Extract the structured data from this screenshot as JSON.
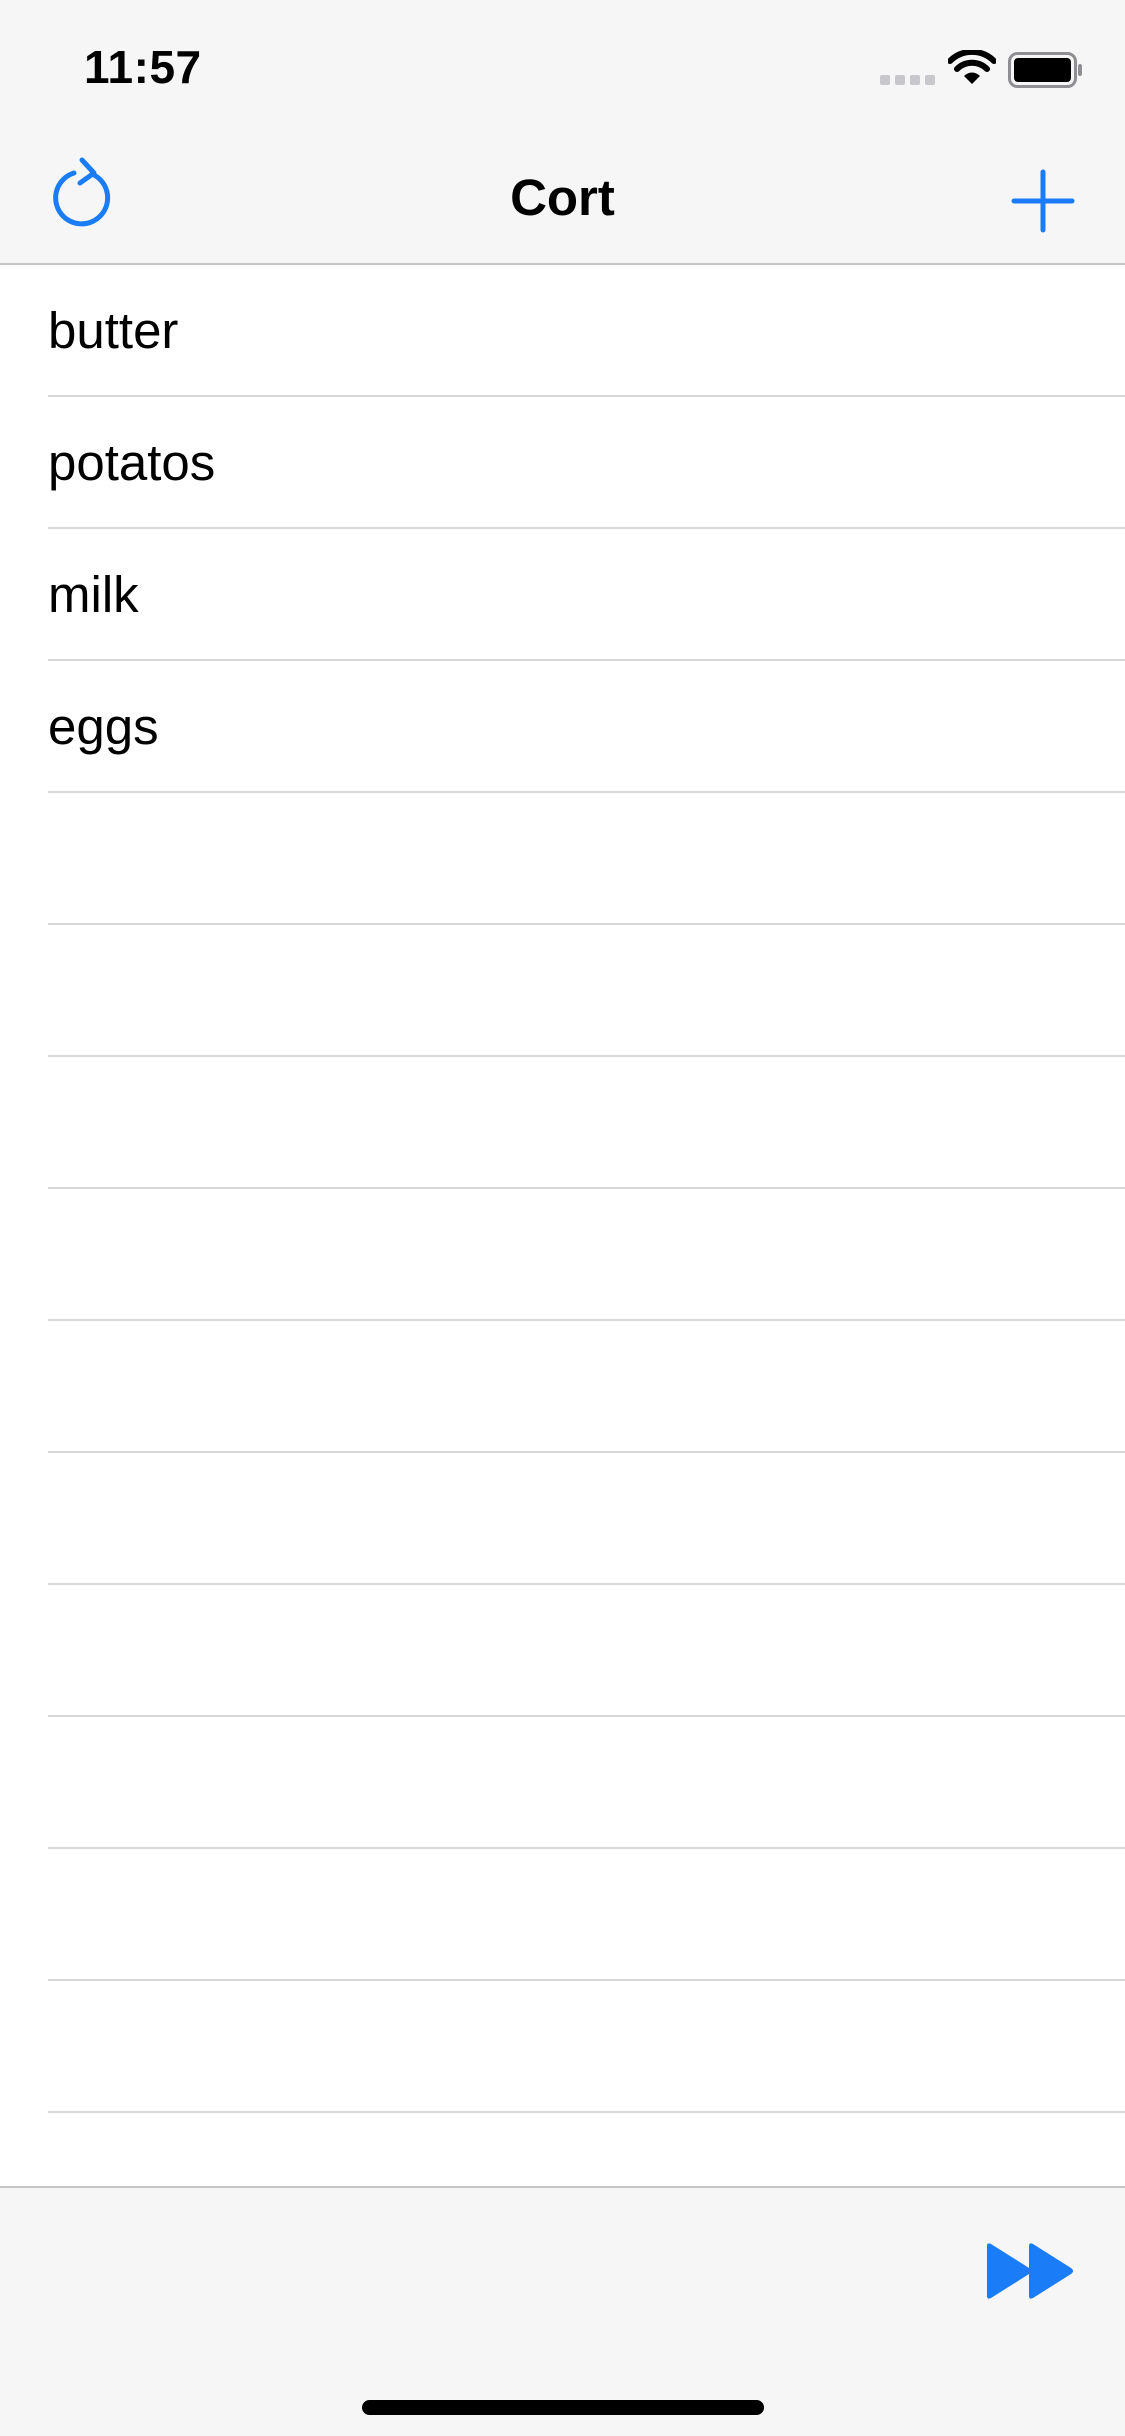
{
  "status_bar": {
    "time": "11:57",
    "icons": [
      "signal-dots-icon",
      "wifi-icon",
      "battery-icon"
    ]
  },
  "nav": {
    "title": "Cort",
    "left_icon": "refresh-icon",
    "right_icon": "plus-icon",
    "accent_color": "#1a7cf6"
  },
  "list": {
    "items": [
      {
        "label": "butter"
      },
      {
        "label": "potatos"
      },
      {
        "label": "milk"
      },
      {
        "label": "eggs"
      },
      {
        "label": ""
      },
      {
        "label": ""
      },
      {
        "label": ""
      },
      {
        "label": ""
      },
      {
        "label": ""
      },
      {
        "label": ""
      },
      {
        "label": ""
      },
      {
        "label": ""
      },
      {
        "label": ""
      },
      {
        "label": ""
      },
      {
        "label": ""
      }
    ]
  },
  "toolbar": {
    "right_icon": "fast-forward-icon"
  }
}
